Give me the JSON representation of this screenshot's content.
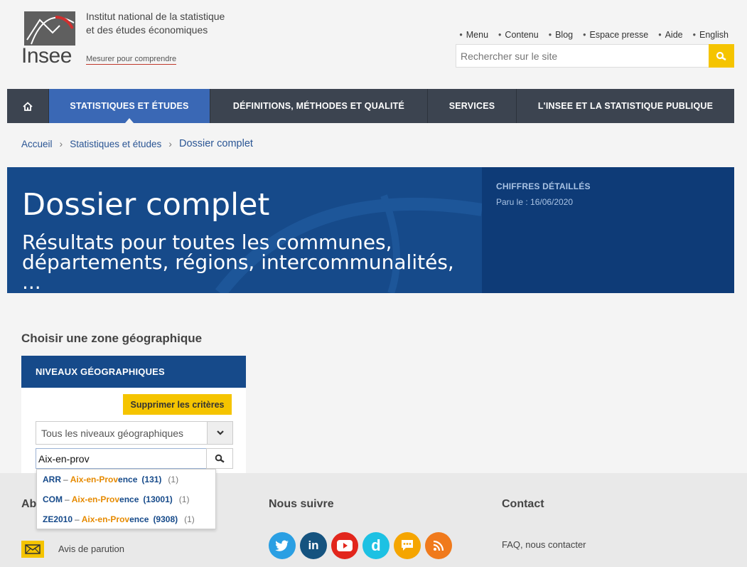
{
  "header": {
    "logo_text": "Insee",
    "org_name_line1": "Institut national de la statistique",
    "org_name_line2": "et des études économiques",
    "tagline": "Mesurer pour comprendre",
    "top_links": [
      "Menu",
      "Contenu",
      "Blog",
      "Espace presse",
      "Aide",
      "English"
    ],
    "search_placeholder": "Rechercher sur le site"
  },
  "nav": {
    "items": [
      {
        "label": "STATISTIQUES ET ÉTUDES",
        "active": true
      },
      {
        "label": "DÉFINITIONS, MÉTHODES ET QUALITÉ"
      },
      {
        "label": "SERVICES"
      },
      {
        "label": "L'INSEE ET LA STATISTIQUE PUBLIQUE"
      }
    ]
  },
  "breadcrumb": {
    "items": [
      "Accueil",
      "Statistiques et études"
    ],
    "current": "Dossier complet"
  },
  "banner": {
    "title": "Dossier complet",
    "subtitle": "Résultats pour toutes les communes, départements, régions, intercommunalités, ...",
    "category": "CHIFFRES DÉTAILLÉS",
    "date": "Paru le : 16/06/2020"
  },
  "geo": {
    "section_title": "Choisir une zone géographique",
    "panel_title": "NIVEAUX GÉOGRAPHIQUES",
    "clear_button": "Supprimer les critères",
    "level_select": "Tous les niveaux géographiques",
    "query": "Aix-en-prov",
    "suggestions": [
      {
        "code": "ARR",
        "match": "Aix-en-Prov",
        "rest": "ence",
        "id": "(131)",
        "count": "(1)"
      },
      {
        "code": "COM",
        "match": "Aix-en-Prov",
        "rest": "ence",
        "id": "(13001)",
        "count": "(1)"
      },
      {
        "code": "ZE2010",
        "match": "Aix-en-Prov",
        "rest": "ence",
        "id": "(9308)",
        "count": "(1)"
      }
    ]
  },
  "footer": {
    "col1_title": "Ab",
    "col2_title": "Nous suivre",
    "col3_title": "Contact",
    "mail_label": "Avis de parution",
    "contact_link": "FAQ, nous contacter",
    "socials": [
      "twitter",
      "linkedin",
      "youtube",
      "dailymotion",
      "blog",
      "rss"
    ]
  },
  "colors": {
    "nav_bg": "#3c4450",
    "nav_active": "#3a68b5",
    "banner": "#164a8a",
    "accent_yellow": "#f5c400",
    "highlight_orange": "#e68a00"
  }
}
